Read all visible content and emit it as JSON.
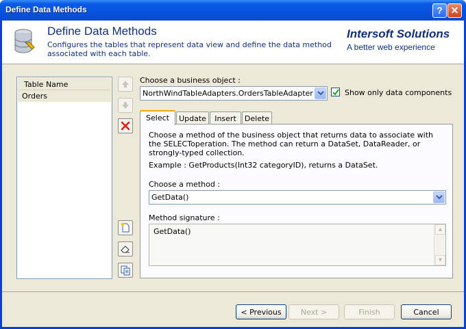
{
  "window": {
    "title": "Define Data Methods",
    "help_glyph": "?",
    "close_glyph": "✕"
  },
  "header": {
    "title": "Define Data Methods",
    "description": "Configures the tables that represent data view and define the data method associated with each table.",
    "brand": "Intersoft Solutions",
    "tagline": "A better web experience"
  },
  "table_list": {
    "header": "Table Name",
    "items": [
      "Orders"
    ]
  },
  "business_object": {
    "label": "Choose a business object :",
    "value": "NorthWindTableAdapters.OrdersTableAdapter",
    "show_only_label": "Show only data components",
    "show_only_checked": true
  },
  "tabs": [
    "Select",
    "Update",
    "Insert",
    "Delete"
  ],
  "active_tab": "Select",
  "select_tab": {
    "description": "Choose a method of the business object that returns data to associate with the SELECToperation. The method can return a DataSet, DataReader, or strongly-typed collection.",
    "example": "Example : GetProducts(Int32 categoryID), returns a DataSet.",
    "method_label": "Choose a method :",
    "method_value": "GetData()",
    "signature_label": "Method signature :",
    "signature_value": "GetData()"
  },
  "buttons": {
    "previous": "< Previous",
    "next": "Next >",
    "finish": "Finish",
    "cancel": "Cancel"
  },
  "colors": {
    "titlebar": "#0652dd",
    "header_text": "#12307a",
    "tab_accent": "#f6a600",
    "delete_red": "#e02010"
  }
}
